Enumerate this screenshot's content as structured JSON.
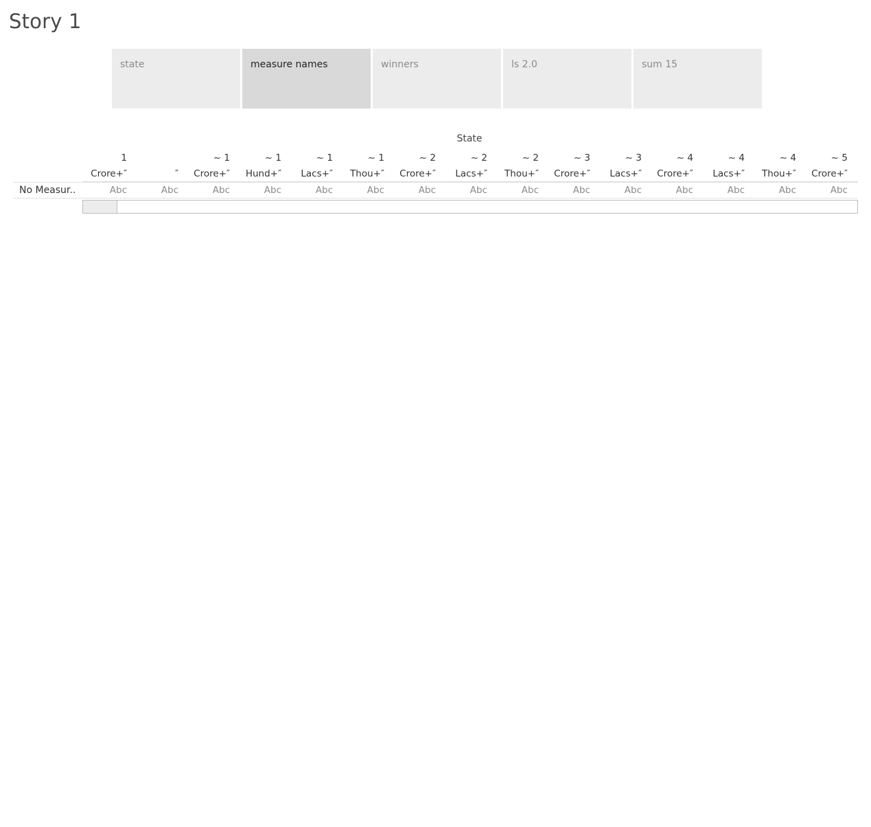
{
  "story": {
    "title": "Story 1"
  },
  "story_points": [
    {
      "label": "state",
      "active": false
    },
    {
      "label": "measure names",
      "active": true
    },
    {
      "label": "winners",
      "active": false
    },
    {
      "label": "ls 2.0",
      "active": false
    },
    {
      "label": "sum 15",
      "active": false
    }
  ],
  "table": {
    "column_field": "State",
    "row_label": "No Measur..",
    "columns": [
      {
        "line1": "1",
        "line2": "Crore+″",
        "value": "Abc"
      },
      {
        "line1": "",
        "line2": "″",
        "value": "Abc"
      },
      {
        "line1": "~ 1",
        "line2": "Crore+″",
        "value": "Abc"
      },
      {
        "line1": "~ 1",
        "line2": "Hund+″",
        "value": "Abc"
      },
      {
        "line1": "~ 1",
        "line2": "Lacs+″",
        "value": "Abc"
      },
      {
        "line1": "~ 1",
        "line2": "Thou+″",
        "value": "Abc"
      },
      {
        "line1": "~ 2",
        "line2": "Crore+″",
        "value": "Abc"
      },
      {
        "line1": "~ 2",
        "line2": "Lacs+″",
        "value": "Abc"
      },
      {
        "line1": "~ 2",
        "line2": "Thou+″",
        "value": "Abc"
      },
      {
        "line1": "~ 3",
        "line2": "Crore+″",
        "value": "Abc"
      },
      {
        "line1": "~ 3",
        "line2": "Lacs+″",
        "value": "Abc"
      },
      {
        "line1": "~ 4",
        "line2": "Crore+″",
        "value": "Abc"
      },
      {
        "line1": "~ 4",
        "line2": "Lacs+″",
        "value": "Abc"
      },
      {
        "line1": "~ 4",
        "line2": "Thou+″",
        "value": "Abc"
      },
      {
        "line1": "~ 5",
        "line2": "Crore+″",
        "value": "Abc"
      }
    ]
  },
  "colors": {
    "story_point_bg": "#ececec",
    "story_point_active_bg": "#d9d9d9",
    "muted_text": "#8a8a8a"
  }
}
